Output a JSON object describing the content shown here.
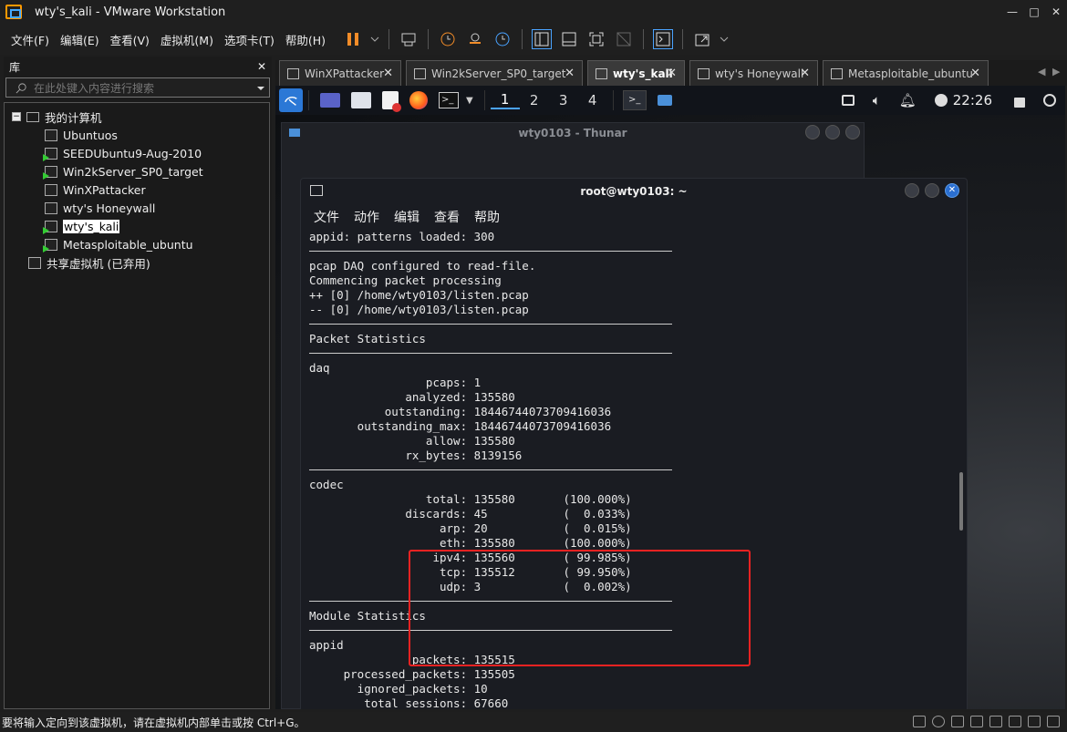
{
  "window": {
    "title": "wty's_kali - VMware Workstation",
    "minimize": "—",
    "maximize": "□",
    "close": "✕"
  },
  "menu": [
    "文件(F)",
    "编辑(E)",
    "查看(V)",
    "虚拟机(M)",
    "选项卡(T)",
    "帮助(H)"
  ],
  "library": {
    "title": "库",
    "close": "✕",
    "search_placeholder": "在此处键入内容进行搜索",
    "root": "我的计算机",
    "vms": [
      {
        "name": "Ubuntuos",
        "running": false
      },
      {
        "name": "SEEDUbuntu9-Aug-2010",
        "running": true
      },
      {
        "name": "Win2kServer_SP0_target",
        "running": true
      },
      {
        "name": "WinXPattacker",
        "running": false
      },
      {
        "name": "wty's Honeywall",
        "running": false
      },
      {
        "name": "wty's_kali",
        "running": true,
        "selected": true
      },
      {
        "name": "Metasploitable_ubuntu",
        "running": true
      }
    ],
    "shared": "共享虚拟机 (已弃用)",
    "expander": "−"
  },
  "tabs": [
    {
      "label": "WinXPattacker",
      "active": false
    },
    {
      "label": "Win2kServer_SP0_target",
      "active": false
    },
    {
      "label": "wty's_kali",
      "active": true
    },
    {
      "label": "wty's Honeywall",
      "active": false
    },
    {
      "label": "Metasploitable_ubuntu",
      "active": false
    }
  ],
  "kali_panel": {
    "workspaces": [
      "1",
      "2",
      "3",
      "4"
    ],
    "active_workspace": "1",
    "clock": "22:26"
  },
  "thunar": {
    "title": "wty0103 - Thunar"
  },
  "terminal": {
    "title": "root@wty0103: ~",
    "menu": [
      "文件",
      "动作",
      "编辑",
      "查看",
      "帮助"
    ],
    "lines": [
      "appid: patterns loaded: 300",
      "---",
      "pcap DAQ configured to read-file.",
      "Commencing packet processing",
      "++ [0] /home/wty0103/listen.pcap",
      "-- [0] /home/wty0103/listen.pcap",
      "---",
      "Packet Statistics",
      "---",
      "daq",
      "                 pcaps: 1",
      "              analyzed: 135580",
      "           outstanding: 18446744073709416036",
      "       outstanding_max: 18446744073709416036",
      "                 allow: 135580",
      "              rx_bytes: 8139156",
      "---",
      "codec",
      "                 total: 135580       (100.000%)",
      "              discards: 45           (  0.033%)",
      "                   arp: 20           (  0.015%)",
      "                   eth: 135580       (100.000%)",
      "                  ipv4: 135560       ( 99.985%)",
      "                   tcp: 135512       ( 99.950%)",
      "                   udp: 3            (  0.002%)",
      "---",
      "Module Statistics",
      "---",
      "appid",
      "               packets: 135515",
      "     processed_packets: 135505",
      "       ignored_packets: 10",
      "        total_sessions: 67660"
    ]
  },
  "status": {
    "text": "要将输入定向到该虚拟机，请在虚拟机内部单击或按 Ctrl+G。"
  },
  "colors": {
    "accent": "#4aa3ff",
    "highlight_box": "#e22222",
    "play_green": "#33cc33",
    "pause_orange": "#f28c28"
  }
}
